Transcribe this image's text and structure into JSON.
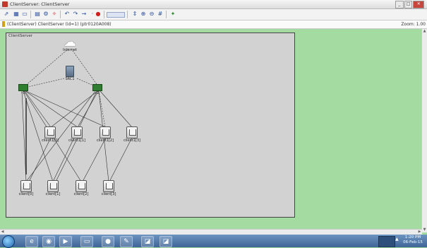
{
  "window": {
    "title": "ClientServer: ClientServer",
    "controls": [
      "_",
      "□",
      "✕"
    ]
  },
  "infobar": {
    "status": "(ClientServer) ClientServer  (id=1)  (ptr0120A008)",
    "zoom": "Zoom: 1.00"
  },
  "network": {
    "name": "ClientServer",
    "internet_label": "Internet",
    "server_label": "SRC1",
    "router_labels": [
      "r1",
      "r2"
    ],
    "client_top_labels": [
      "client1[0]",
      "client1[1]",
      "client1[2]",
      "client1[3]"
    ],
    "client_bottom_labels": [
      "client[0]",
      "client[1]",
      "client[2]",
      "client[3]"
    ]
  },
  "toolbar": {
    "icons": [
      "run-icon",
      "layout-icon",
      "inspect-icon",
      "record-icon",
      "params-icon",
      "step-icon",
      "undo-icon",
      "redo-icon",
      "fast-icon",
      "stop-icon",
      "speed-slider",
      "find-icon",
      "zoom-in-icon",
      "zoom-out-icon",
      "grid-icon",
      "animate-icon"
    ]
  },
  "taskbar": {
    "apps": [
      "ie-icon",
      "chrome-icon",
      "media-icon",
      "folder-icon",
      "firefox-icon",
      "paint-icon",
      "omnet-icon",
      "omnet-icon"
    ],
    "time": "1:20 PM",
    "date": "06-Feb-15"
  }
}
